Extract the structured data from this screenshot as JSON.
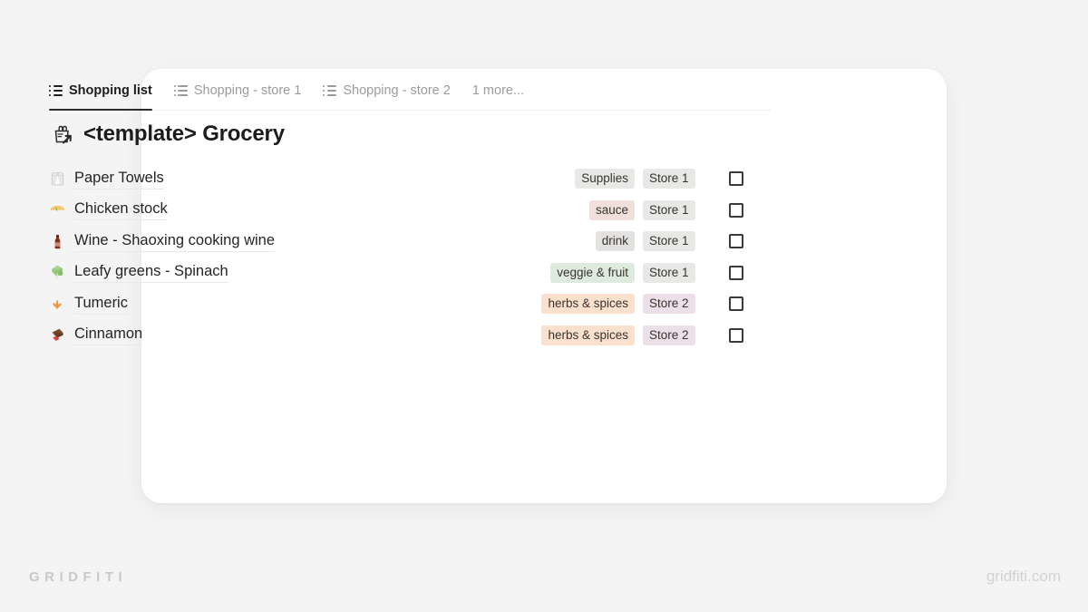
{
  "page": {
    "background_color": "#f4f4f4",
    "card_color": "#ffffff"
  },
  "tabs": {
    "items": [
      {
        "label": "Shopping list",
        "icon": "list-icon",
        "active": true
      },
      {
        "label": "Shopping - store 1",
        "icon": "list-icon",
        "active": false
      },
      {
        "label": "Shopping - store 2",
        "icon": "list-icon",
        "active": false
      }
    ],
    "more_label": "1 more...",
    "active_underline_color": "#2c2c2c"
  },
  "title": {
    "text": "<template> Grocery",
    "icon": "shopping-bag-link-icon"
  },
  "table": {
    "rows": [
      {
        "emoji": "paper-towel-roll-icon",
        "name": "Paper Towels",
        "tag": {
          "label": "Supplies",
          "bg": "#e8e8e6",
          "fg": "#37352f"
        },
        "store": {
          "label": "Store 1",
          "bg": "#e8e8e6",
          "fg": "#37352f"
        },
        "checked": false
      },
      {
        "emoji": "soup-bowl-icon",
        "name": "Chicken stock",
        "tag": {
          "label": "sauce",
          "bg": "#f0e0dc",
          "fg": "#37352f"
        },
        "store": {
          "label": "Store 1",
          "bg": "#e8e8e6",
          "fg": "#37352f"
        },
        "checked": false
      },
      {
        "emoji": "wine-bottle-icon",
        "name": "Wine - Shaoxing cooking wine",
        "tag": {
          "label": "drink",
          "bg": "#e3e2e0",
          "fg": "#37352f"
        },
        "store": {
          "label": "Store 1",
          "bg": "#e8e8e6",
          "fg": "#37352f"
        },
        "checked": false
      },
      {
        "emoji": "leafy-green-icon",
        "name": "Leafy greens - Spinach",
        "tag": {
          "label": "veggie & fruit",
          "bg": "#dfeade",
          "fg": "#37352f"
        },
        "store": {
          "label": "Store 1",
          "bg": "#e8e8e6",
          "fg": "#37352f"
        },
        "checked": false
      },
      {
        "emoji": "ginger-root-icon",
        "name": "Tumeric",
        "tag": {
          "label": "herbs & spices",
          "bg": "#fae0cd",
          "fg": "#37352f"
        },
        "store": {
          "label": "Store 2",
          "bg": "#ecdfe8",
          "fg": "#37352f"
        },
        "checked": false
      },
      {
        "emoji": "cinnamon-bar-icon",
        "name": "Cinnamon",
        "tag": {
          "label": "herbs & spices",
          "bg": "#fae0cd",
          "fg": "#37352f"
        },
        "store": {
          "label": "Store 2",
          "bg": "#ecdfe8",
          "fg": "#37352f"
        },
        "checked": false
      }
    ]
  },
  "footer": {
    "brand_left": "GRIDFITI",
    "brand_right": "gridfiti.com"
  }
}
